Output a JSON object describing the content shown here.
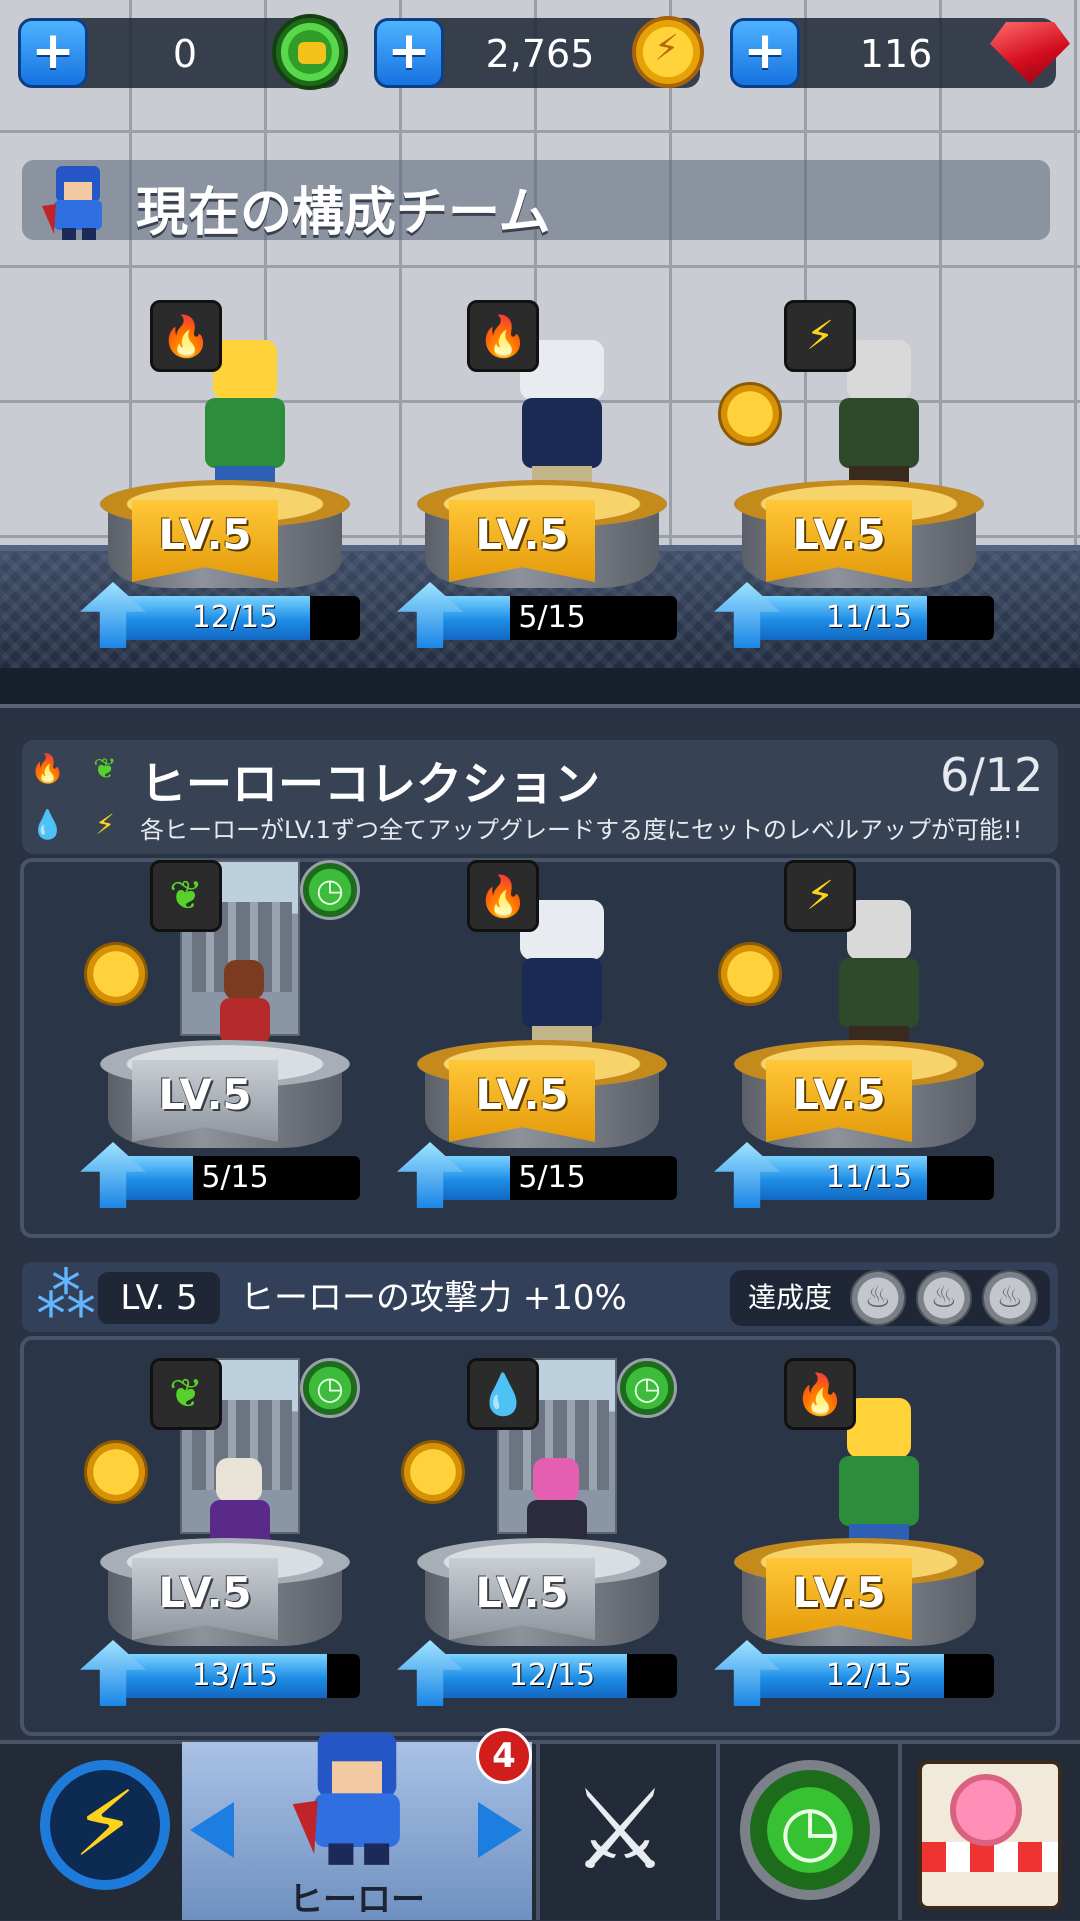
{
  "currency": {
    "tickets": "0",
    "coins": "2,765",
    "gems": "116"
  },
  "team": {
    "title": "現在の構成チーム",
    "heroes": [
      {
        "element": "fire",
        "level": "LV.5",
        "progress_text": "12/15",
        "progress": 0.8
      },
      {
        "element": "fire",
        "level": "LV.5",
        "progress_text": "5/15",
        "progress": 0.3333
      },
      {
        "element": "thunder",
        "level": "LV.5",
        "progress_text": "11/15",
        "progress": 0.7333
      }
    ]
  },
  "collection": {
    "title": "ヒーローコレクション",
    "count": "6/12",
    "description": "各ヒーローがLV.1ずつ全てアップグレードする度にセットのレベルアップが可能!!",
    "heroes": [
      {
        "element": "leaf",
        "level": "LV.5",
        "progress_text": "5/15",
        "progress": 0.3333
      },
      {
        "element": "fire",
        "level": "LV.5",
        "progress_text": "5/15",
        "progress": 0.3333
      },
      {
        "element": "thunder",
        "level": "LV.5",
        "progress_text": "11/15",
        "progress": 0.7333
      }
    ]
  },
  "set": {
    "level": "LV. 5",
    "bonus": "ヒーローの攻撃力 +10%",
    "achievement_label": "達成度",
    "heroes": [
      {
        "element": "leaf",
        "level": "LV.5",
        "progress_text": "13/15",
        "progress": 0.8667
      },
      {
        "element": "water",
        "level": "LV.5",
        "progress_text": "12/15",
        "progress": 0.8
      },
      {
        "element": "fire",
        "level": "LV.5",
        "progress_text": "12/15",
        "progress": 0.8
      }
    ]
  },
  "nav": {
    "hero_label": "ヒーロー",
    "hero_badge": "4"
  },
  "icons": {
    "fire": "🔥",
    "leaf": "❦",
    "thunder": "⚡",
    "water": "💧",
    "clock": "◷",
    "achievement": "♨"
  },
  "colors": {
    "accent_blue": "#1e8de6",
    "ribbon_gold": "#ffc737",
    "badge_red": "#d21d1d"
  }
}
